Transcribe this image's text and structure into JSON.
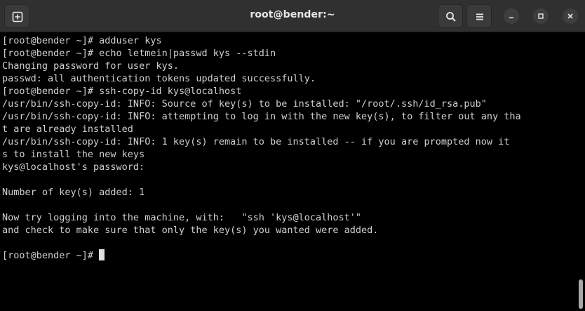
{
  "window": {
    "title": "root@bender:~"
  },
  "icons": {
    "new_tab": "new-tab-icon",
    "search": "search-icon",
    "menu": "hamburger-menu-icon",
    "minimize": "minimize-icon",
    "maximize": "maximize-icon",
    "close": "close-icon"
  },
  "colors": {
    "titlebar": "#303030",
    "terminal_bg": "#000000",
    "terminal_fg": "#d0d0d0"
  },
  "terminal": {
    "lines": [
      "[root@bender ~]# adduser kys",
      "[root@bender ~]# echo letmein|passwd kys --stdin",
      "Changing password for user kys.",
      "passwd: all authentication tokens updated successfully.",
      "[root@bender ~]# ssh-copy-id kys@localhost",
      "/usr/bin/ssh-copy-id: INFO: Source of key(s) to be installed: \"/root/.ssh/id_rsa.pub\"",
      "/usr/bin/ssh-copy-id: INFO: attempting to log in with the new key(s), to filter out any tha",
      "t are already installed",
      "/usr/bin/ssh-copy-id: INFO: 1 key(s) remain to be installed -- if you are prompted now it",
      "s to install the new keys",
      "kys@localhost's password: ",
      "",
      "Number of key(s) added: 1",
      "",
      "Now try logging into the machine, with:   \"ssh 'kys@localhost'\"",
      "and check to make sure that only the key(s) you wanted were added.",
      ""
    ],
    "prompt": "[root@bender ~]# "
  }
}
